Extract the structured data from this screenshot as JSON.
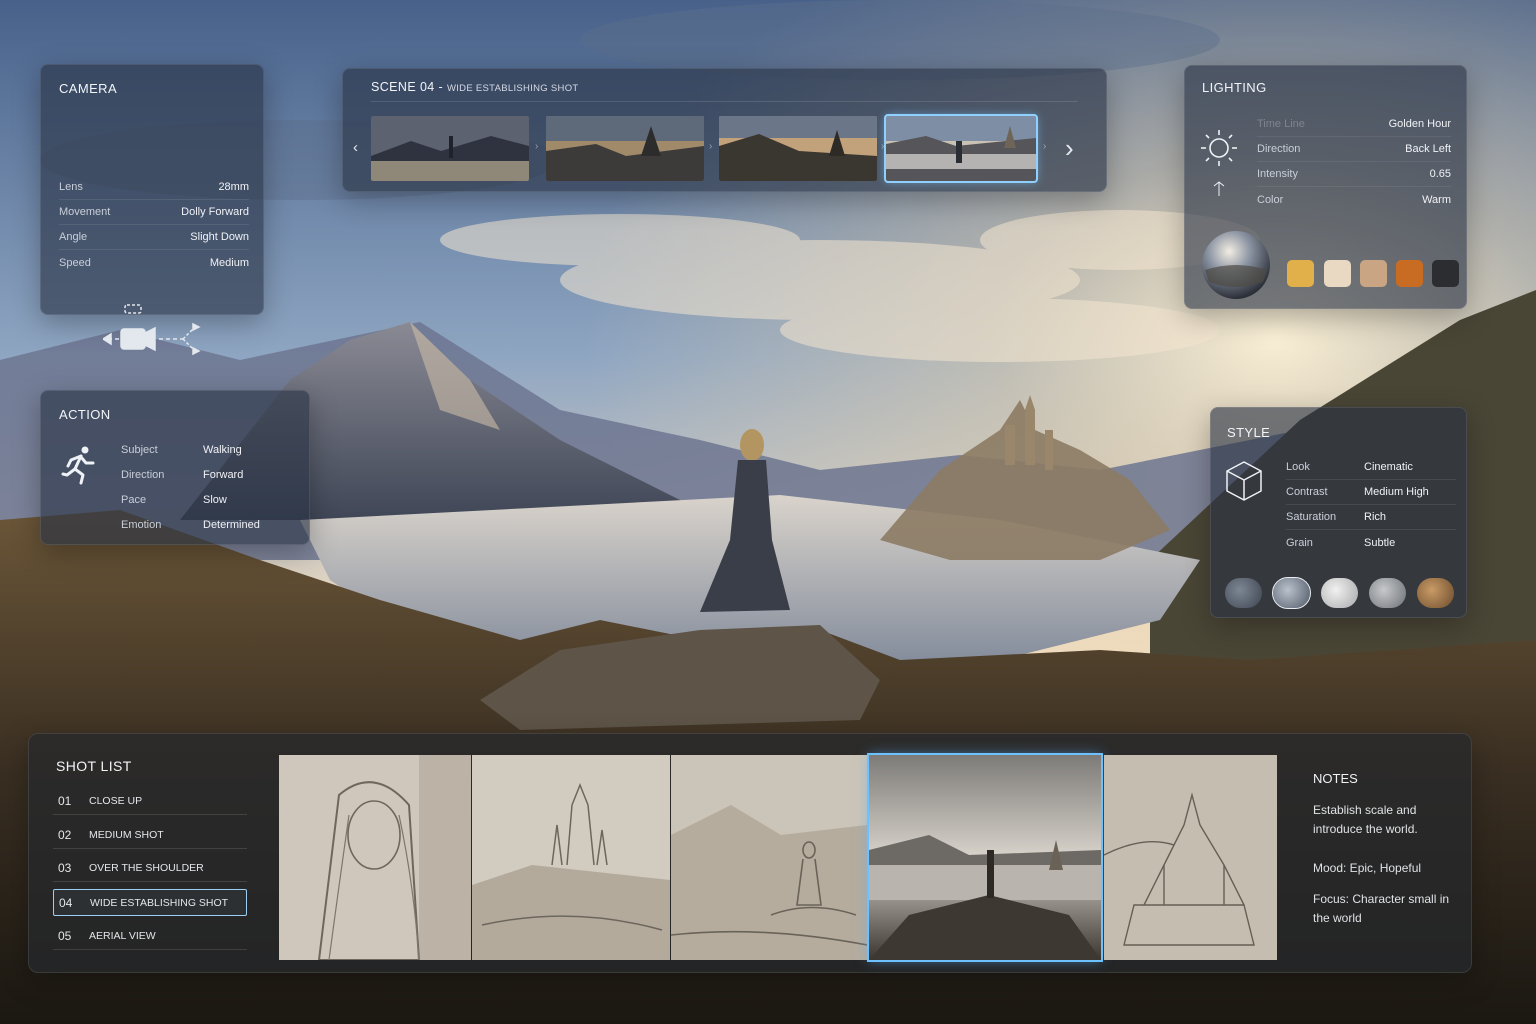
{
  "camera": {
    "title": "CAMERA",
    "rows": [
      {
        "key": "Lens",
        "value": "28mm"
      },
      {
        "key": "Movement",
        "value": "Dolly Forward"
      },
      {
        "key": "Angle",
        "value": "Slight Down"
      },
      {
        "key": "Speed",
        "value": "Medium"
      }
    ],
    "rig_icon": "camera-dolly-icon"
  },
  "scene": {
    "title": "SCENE 04",
    "separator": " - ",
    "subtitle": "WIDE ESTABLISHING SHOT",
    "thumbnails": [
      "frame-1",
      "frame-2",
      "frame-3",
      "frame-4"
    ],
    "active_thumbnail": 3,
    "prev_icon": "chevron-left-icon",
    "next_icon": "chevron-right-icon"
  },
  "lighting": {
    "title": "LIGHTING",
    "rows": [
      {
        "key": "Time Line",
        "value": "Golden Hour"
      },
      {
        "key": "Direction",
        "value": "Back Left"
      },
      {
        "key": "Intensity",
        "value": "0.65"
      },
      {
        "key": "Color",
        "value": "Warm"
      }
    ],
    "swatches": [
      "#e2b04a",
      "#e9d8c2",
      "#c9a583",
      "#c86c24",
      "#2b2d31"
    ],
    "icon": "sun-icon"
  },
  "action": {
    "title": "ACTION",
    "rows": [
      {
        "key": "Subject",
        "value": "Walking"
      },
      {
        "key": "Direction",
        "value": "Forward"
      },
      {
        "key": "Pace",
        "value": "Slow"
      },
      {
        "key": "Emotion",
        "value": "Determined"
      }
    ],
    "icon": "running-person-icon"
  },
  "style": {
    "title": "STYLE",
    "rows": [
      {
        "key": "Look",
        "value": "Cinematic"
      },
      {
        "key": "Contrast",
        "value": "Medium High"
      },
      {
        "key": "Saturation",
        "value": "Rich"
      },
      {
        "key": "Grain",
        "value": "Subtle"
      }
    ],
    "icon": "cube-icon",
    "presets": [
      "#4b5560",
      "#7d8a97",
      "#d6d8da",
      "#9a9ea3",
      "#a67a4c"
    ],
    "active_preset": 1
  },
  "shot_list": {
    "title": "SHOT LIST",
    "shots": [
      {
        "num": "01",
        "label": "CLOSE UP"
      },
      {
        "num": "02",
        "label": "MEDIUM SHOT"
      },
      {
        "num": "03",
        "label": "OVER THE SHOULDER"
      },
      {
        "num": "04",
        "label": "WIDE ESTABLISHING SHOT"
      },
      {
        "num": "05",
        "label": "AERIAL VIEW"
      }
    ],
    "active_shot": 3,
    "boards": [
      "sketch-closeup",
      "sketch-castle",
      "sketch-figure",
      "render-wide",
      "sketch-aerial"
    ],
    "active_board": 3
  },
  "notes": {
    "title": "NOTES",
    "lines": [
      "Establish scale and introduce the world.",
      "Mood: Epic, Hopeful",
      "Focus: Character small in the world"
    ]
  }
}
